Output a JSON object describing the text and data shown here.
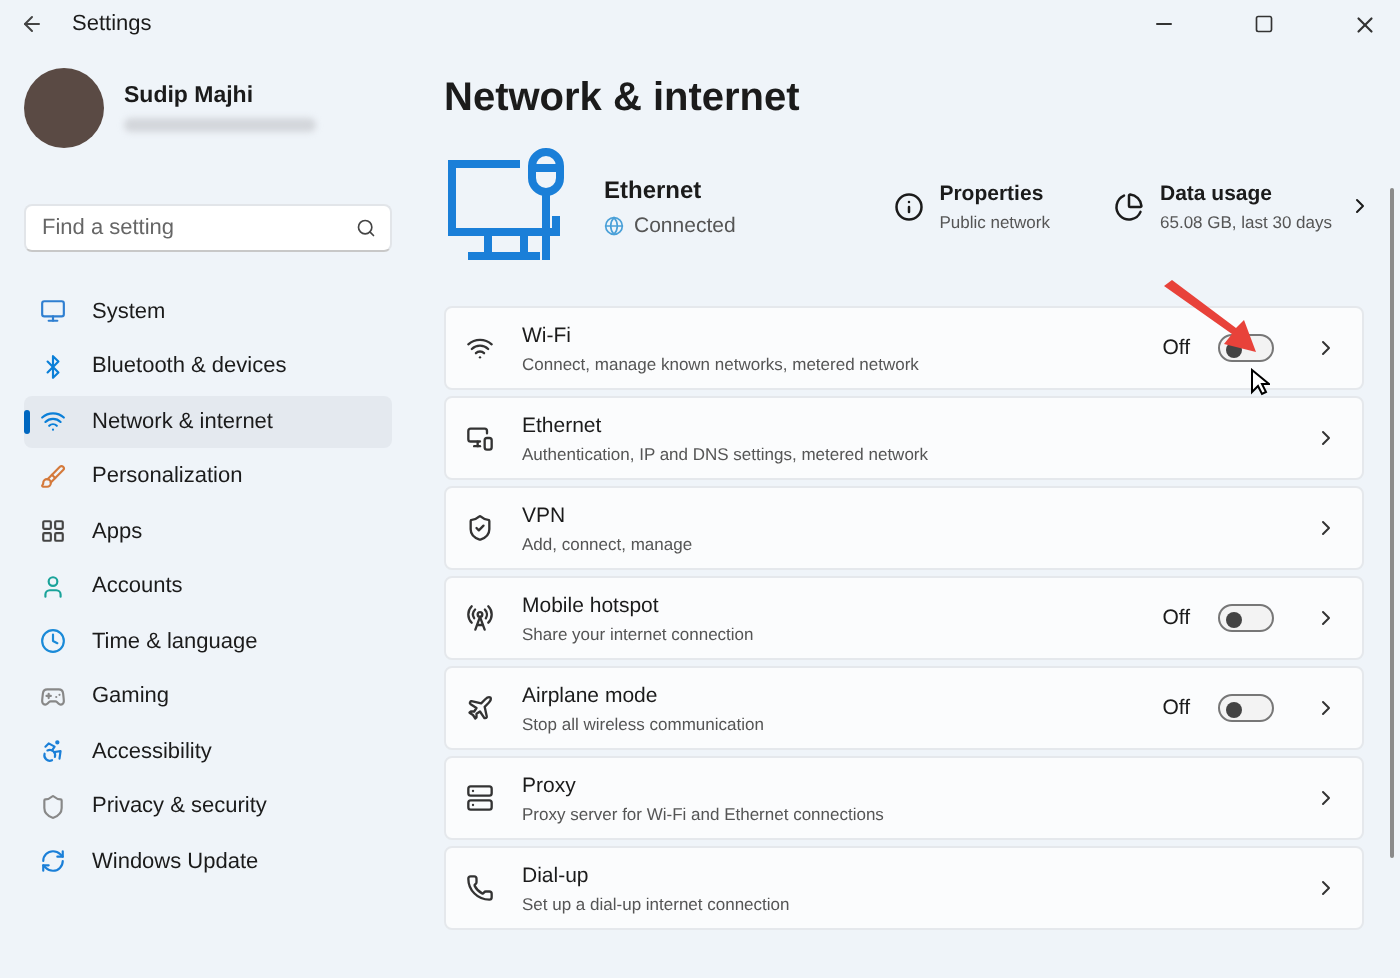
{
  "window": {
    "title": "Settings"
  },
  "account": {
    "name": "Sudip Majhi"
  },
  "search": {
    "placeholder": "Find a setting"
  },
  "sidebar": {
    "items": [
      {
        "label": "System",
        "selected": false
      },
      {
        "label": "Bluetooth & devices",
        "selected": false
      },
      {
        "label": "Network & internet",
        "selected": true
      },
      {
        "label": "Personalization",
        "selected": false
      },
      {
        "label": "Apps",
        "selected": false
      },
      {
        "label": "Accounts",
        "selected": false
      },
      {
        "label": "Time & language",
        "selected": false
      },
      {
        "label": "Gaming",
        "selected": false
      },
      {
        "label": "Accessibility",
        "selected": false
      },
      {
        "label": "Privacy & security",
        "selected": false
      },
      {
        "label": "Windows Update",
        "selected": false
      }
    ]
  },
  "page": {
    "title": "Network & internet"
  },
  "connection": {
    "name": "Ethernet",
    "status": "Connected",
    "properties": {
      "title": "Properties",
      "subtitle": "Public network"
    },
    "data_usage": {
      "title": "Data usage",
      "subtitle": "65.08 GB, last 30 days"
    }
  },
  "rows": [
    {
      "kind": "toggle",
      "title": "Wi-Fi",
      "subtitle": "Connect, manage known networks, metered network",
      "state_label": "Off",
      "on": false
    },
    {
      "kind": "link",
      "title": "Ethernet",
      "subtitle": "Authentication, IP and DNS settings, metered network"
    },
    {
      "kind": "link",
      "title": "VPN",
      "subtitle": "Add, connect, manage"
    },
    {
      "kind": "toggle",
      "title": "Mobile hotspot",
      "subtitle": "Share your internet connection",
      "state_label": "Off",
      "on": false
    },
    {
      "kind": "toggle",
      "title": "Airplane mode",
      "subtitle": "Stop all wireless communication",
      "state_label": "Off",
      "on": false
    },
    {
      "kind": "link",
      "title": "Proxy",
      "subtitle": "Proxy server for Wi-Fi and Ethernet connections"
    },
    {
      "kind": "link",
      "title": "Dial-up",
      "subtitle": "Set up a dial-up internet connection"
    }
  ]
}
